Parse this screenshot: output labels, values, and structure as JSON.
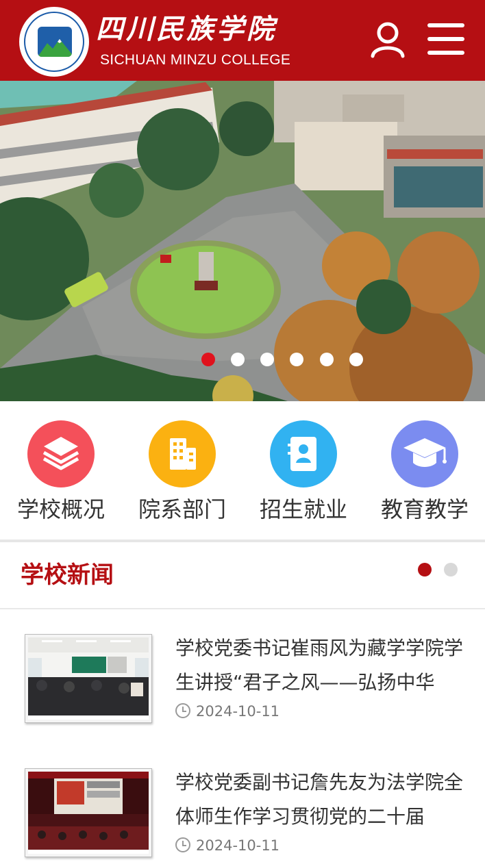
{
  "header": {
    "title": "四川民族学院",
    "subtitle": "SICHUAN MINZU COLLEGE",
    "icons": {
      "user": "user-icon",
      "menu": "menu-icon"
    },
    "colors": {
      "brand": "#b50f13"
    }
  },
  "banner": {
    "slide_count": 6,
    "active_index": 0,
    "colors": {
      "active_dot": "#e0121d",
      "dot": "#ffffff"
    }
  },
  "quicknav": [
    {
      "label": "学校概况",
      "icon": "layers-icon",
      "color": "#f4505a"
    },
    {
      "label": "院系部门",
      "icon": "building-icon",
      "color": "#fbb111"
    },
    {
      "label": "招生就业",
      "icon": "contact-card-icon",
      "color": "#31b2f1"
    },
    {
      "label": "教育教学",
      "icon": "graduation-cap-icon",
      "color": "#7b8cf0"
    }
  ],
  "news": {
    "section_title": "学校新闻",
    "page_count": 2,
    "active_page": 0,
    "colors": {
      "active": "#b50f13",
      "inactive": "#d8d8d8"
    },
    "items": [
      {
        "title": "学校党委书记崔雨风为藏学学院学生讲授“君子之风——弘扬中华",
        "date": "2024-10-11"
      },
      {
        "title": "学校党委副书记詹先友为法学院全体师生作学习贯彻党的二十届",
        "date": "2024-10-11"
      }
    ]
  }
}
